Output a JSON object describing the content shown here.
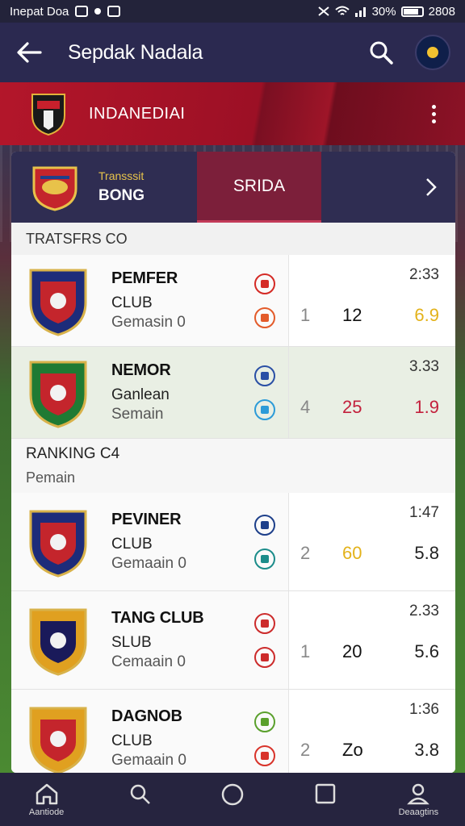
{
  "status_bar": {
    "left_text": "Inepat Doa",
    "right_text": "30%",
    "time": "2808"
  },
  "app_bar": {
    "title": "Sepdak Nadala"
  },
  "banner": {
    "label": "INDANEDIAI"
  },
  "tabs": {
    "first": {
      "small": "Transssit",
      "big": "BONG"
    },
    "second": {
      "label": "SRIDA"
    }
  },
  "section_header": "TRATSFRS CO",
  "ranking": {
    "title": "RANKING C4",
    "subtitle": "Pemain"
  },
  "matches": [
    {
      "name": "PEMFER",
      "line2": "CLUB",
      "line3": "Gemasin 0",
      "time": "2:33",
      "s1": "1",
      "s2": "12",
      "s3": "6.9",
      "s2_color": "#111111",
      "s3_color": "#e3b21a",
      "badge_top": "#d42a25",
      "badge_bottom": "#e35b2a",
      "highlight": false
    },
    {
      "name": "NEMOR",
      "line2": "Ganlean",
      "line3": "Semain",
      "time": "3.33",
      "s1": "4",
      "s2": "25",
      "s3": "1.9",
      "s2_color": "#c3203c",
      "s3_color": "#c3203c",
      "badge_top": "#2a4fa5",
      "badge_bottom": "#2c9bd8",
      "highlight": true
    },
    {
      "name": "PEVINER",
      "line2": "CLUB",
      "line3": "Gemaain 0",
      "time": "1:47",
      "s1": "2",
      "s2": "60",
      "s3": "5.8",
      "s2_color": "#e3b21a",
      "s3_color": "#222222",
      "badge_top": "#1d3f8a",
      "badge_bottom": "#1b8c8a",
      "highlight": false
    },
    {
      "name": "TANG CLUB",
      "line2": "SLUB",
      "line3": "Cemaain 0",
      "time": "2.33",
      "s1": "1",
      "s2": "20",
      "s3": "5.6",
      "s2_color": "#111111",
      "s3_color": "#222222",
      "badge_top": "#cc2b2b",
      "badge_bottom": "#cc2b2b",
      "highlight": false
    },
    {
      "name": "DAGNOB",
      "line2": "CLUB",
      "line3": "Gemaain 0",
      "time": "1:36",
      "s1": "2",
      "s2": "Zo",
      "s3": "3.8",
      "s2_color": "#111111",
      "s3_color": "#222222",
      "badge_top": "#5aa02c",
      "badge_bottom": "#d8332a",
      "highlight": false
    }
  ],
  "bottom_nav": {
    "home_label": "Aantiode",
    "profile_label": "Deaagtins"
  }
}
